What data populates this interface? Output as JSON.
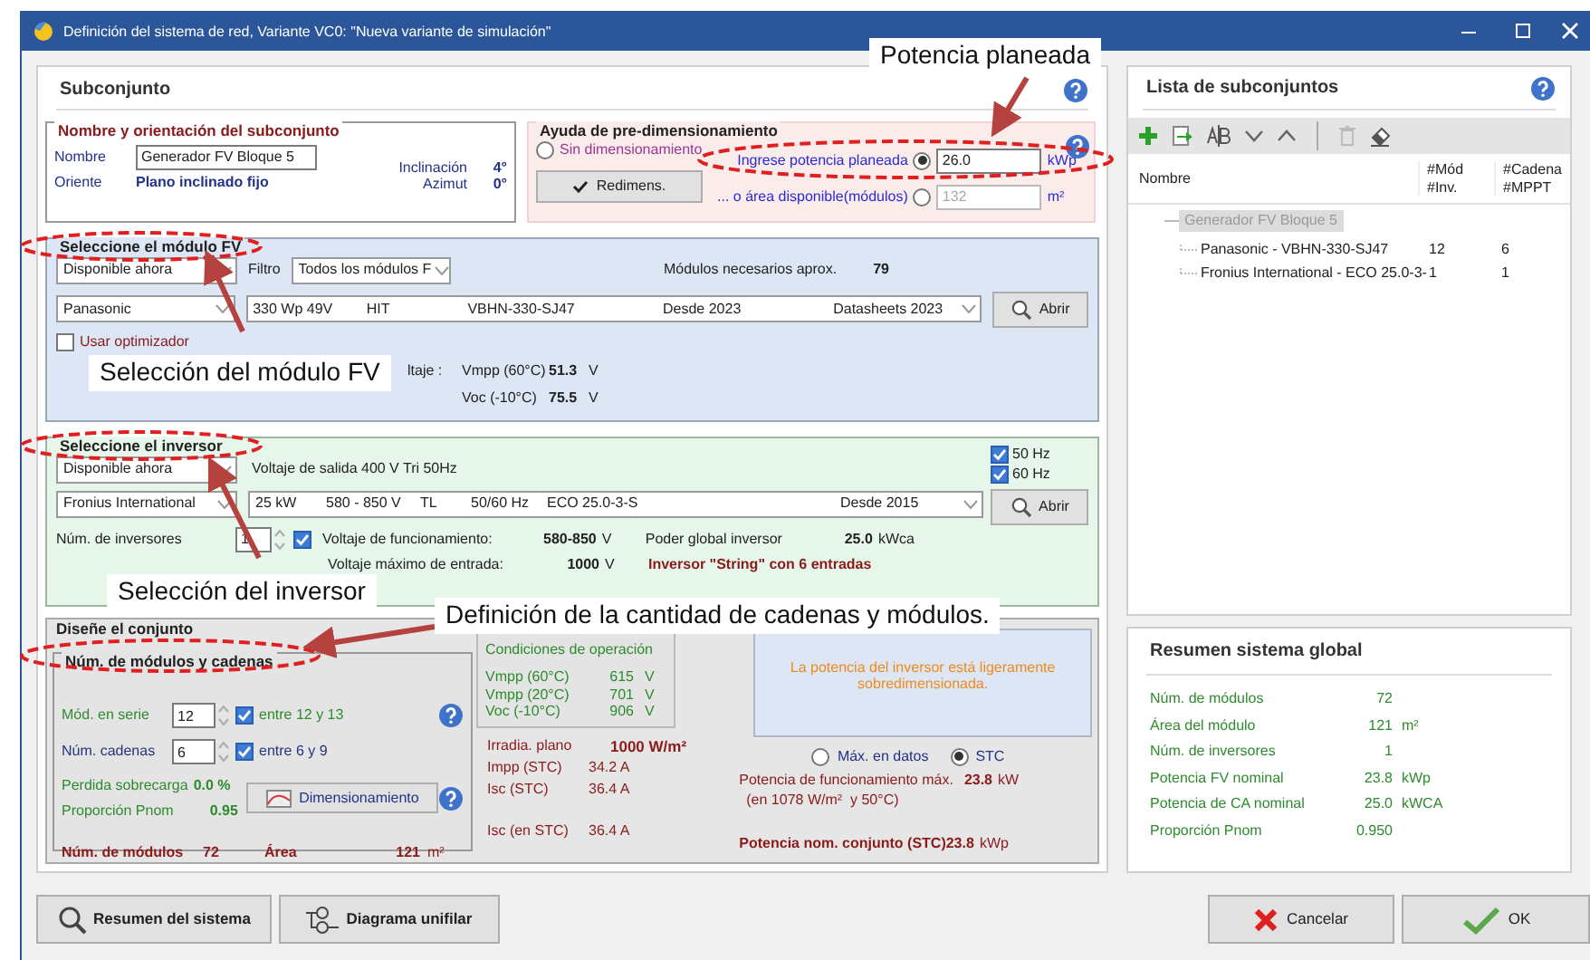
{
  "window": {
    "title": "Definición del sistema de red, Variante VC0:   \"Nueva variante de simulación\""
  },
  "subarray": {
    "title": "Subconjunto"
  },
  "name_orientation": {
    "legend": "Nombre y orientación del subconjunto",
    "name_label": "Nombre",
    "name_value": "Generador FV Bloque 5",
    "orient_label": "Oriente",
    "orient_value": "Plano inclinado fijo",
    "tilt_label": "Inclinación",
    "tilt_value": "4°",
    "azimuth_label": "Azimut",
    "azimuth_value": "0°"
  },
  "presizing": {
    "legend": "Ayuda de pre-dimensionamiento",
    "options": [
      {
        "kind": "plain",
        "label": "Sin dimensionamiento",
        "selected": false
      },
      {
        "kind": "field",
        "label": "Ingrese potencia planeada",
        "selected": true,
        "value": "26.0",
        "unit": "kWp"
      },
      {
        "kind": "field",
        "label": "... o área disponible(módulos)",
        "selected": false,
        "value": "132",
        "unit": "m²"
      }
    ],
    "button": "Redimens."
  },
  "module": {
    "legend": "Seleccione el módulo FV",
    "availability": "Disponible ahora",
    "filter_label": "Filtro",
    "filter": "Todos los módulos F",
    "needed_label": "Módulos necesarios aprox.",
    "needed_value": "79",
    "manufacturer": "Panasonic",
    "model_fields": [
      "330 Wp 49V",
      "HIT",
      "VBHN-330-SJ47",
      "Desde 2023",
      "Datasheets 2023"
    ],
    "open_button": "Abrir",
    "optimizer": {
      "label": "Usar optimizador",
      "checked": false
    },
    "voltage_label": "ltaje :",
    "voltages": [
      {
        "label": "Vmpp (60°C)",
        "value": "51.3",
        "unit": "V"
      },
      {
        "label": "Voc (-10°C)",
        "value": "75.5",
        "unit": "V"
      }
    ]
  },
  "inverter": {
    "legend": "Seleccione el inversor",
    "availability": "Disponible ahora",
    "output_voltage": "Voltaje de salida 400 V Tri 50Hz",
    "frequencies": [
      {
        "label": "50 Hz",
        "checked": true
      },
      {
        "label": "60 Hz",
        "checked": true
      }
    ],
    "manufacturer": "Fronius International",
    "model_fields": [
      "25 kW",
      "580 - 850 V",
      "TL",
      "50/60 Hz",
      "ECO 25.0-3-S",
      "Desde 2015"
    ],
    "open_button": "Abrir",
    "count_label": "Núm. de inversores",
    "count_value": "1",
    "operating": {
      "checked": true,
      "label": "Voltaje de funcionamiento:",
      "value": "580-850",
      "unit": "V"
    },
    "global_power_label": "Poder global inversor",
    "global_power_value": "25.0",
    "global_power_unit": "kWca",
    "max_voltage_label": "Voltaje máximo de entrada:",
    "max_voltage_value": "1000",
    "max_voltage_unit": "V",
    "string_note": "Inversor \"String\" con 6 entradas"
  },
  "design": {
    "legend": "Diseñe el conjunto",
    "strings_legend": "Núm. de módulos y cadenas",
    "inputs": [
      {
        "label": "Mód. en serie",
        "value": "12",
        "checked": true,
        "range": "entre 12 y 13",
        "color": "#2e8b2e"
      },
      {
        "label": "Núm. cadenas",
        "value": "6",
        "checked": true,
        "range": "entre 6 y 9",
        "color": "#26357f"
      }
    ],
    "overload_label": "Perdida sobrecarga",
    "overload_value": "0.0 %",
    "pnom_label": "Proporción Pnom",
    "pnom_value": "0.95",
    "sizing_button": "Dimensionamiento",
    "modules_label": "Núm. de módulos",
    "modules_value": "72",
    "area_label": "Área",
    "area_value": "121",
    "area_unit": "m²",
    "operating_conditions": {
      "title": "Condiciones de operación",
      "rows": [
        {
          "label": "Vmpp (60°C)",
          "value": "615",
          "unit": "V"
        },
        {
          "label": "Vmpp (20°C)",
          "value": "701",
          "unit": "V"
        },
        {
          "label": "Voc (-10°C)",
          "value": "906",
          "unit": "V"
        }
      ]
    },
    "stc": [
      {
        "label": "Irradia. plano",
        "value": "1000 W/m²",
        "kind": "bold"
      },
      {
        "label": "Impp (STC)",
        "value": "34.2 A",
        "kind": "plain"
      },
      {
        "label": "Isc (STC)",
        "value": "36.4 A",
        "kind": "plain"
      },
      {
        "label": "Isc (en STC)",
        "value": "36.4 A",
        "kind": "spaced"
      }
    ],
    "warning": "La potencia del inversor está ligeramente sobredimensionada.",
    "power_modes": [
      {
        "label": "Máx. en datos",
        "selected": false
      },
      {
        "label": "STC",
        "selected": true
      }
    ],
    "max_power_label": "Potencia de funcionamiento máx.",
    "max_power_value": "23.8",
    "max_power_unit": "kW",
    "max_power_note": "(en 1078 W/m²  y 50°C)",
    "nominal_label": "Potencia nom. conjunto (STC)",
    "nominal_value": "23.8",
    "nominal_unit": "kWp"
  },
  "subarray_list": {
    "title": "Lista de subconjuntos",
    "columns": [
      "Nombre",
      "#Mód\n#Inv.",
      "#Cadena\n#MPPT"
    ],
    "tree": [
      {
        "label": "Generador FV Bloque 5",
        "selected": true,
        "children": [
          {
            "label": "Panasonic - VBHN-330-SJ47",
            "column_2": "12",
            "column_3": "6"
          },
          {
            "label": "Fronius International - ECO 25.0-3-",
            "column_2": "1",
            "column_3": "1"
          }
        ]
      }
    ]
  },
  "summary": {
    "title": "Resumen sistema global",
    "rows": [
      {
        "label": "Núm. de módulos",
        "value": "72"
      },
      {
        "label": "Área del módulo",
        "value": "121",
        "unit": "m²"
      },
      {
        "label": "Núm. de inversores",
        "value": "1"
      },
      {
        "label": "Potencia FV nominal",
        "value": "23.8",
        "unit": "kWp"
      },
      {
        "label": "Potencia de CA nominal",
        "value": "25.0",
        "unit": "kWCA"
      },
      {
        "label": "Proporción Pnom",
        "value": "0.950"
      }
    ]
  },
  "buttons": [
    {
      "label": "Resumen del sistema",
      "kind": "search"
    },
    {
      "label": "Diagrama unifilar",
      "kind": "diagram"
    },
    {
      "label": "Cancelar",
      "kind": "cancel"
    },
    {
      "label": "OK",
      "kind": "ok"
    }
  ],
  "annotations": [
    {
      "text": "Potencia planeada"
    },
    {
      "text": "Selección del módulo FV"
    },
    {
      "text": "Selección del inversor"
    },
    {
      "text": "Definición de la cantidad de cadenas y módulos."
    }
  ]
}
